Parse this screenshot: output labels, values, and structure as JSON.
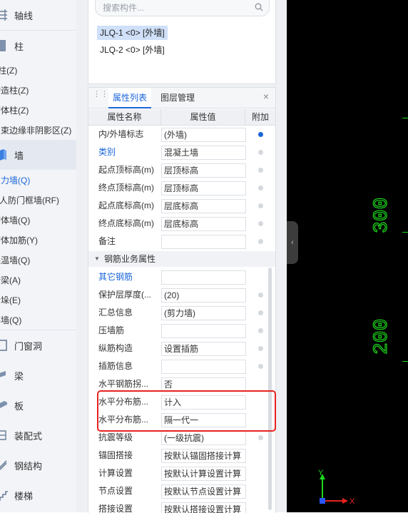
{
  "nav": {
    "groups": [
      {
        "label": "轴线",
        "icon": "axis-grid-icon"
      },
      {
        "label": "柱",
        "icon": "column-icon"
      },
      {
        "label": "墙",
        "icon": "wall-icon"
      },
      {
        "label": "门窗洞",
        "icon": "door-window-icon"
      },
      {
        "label": "梁",
        "icon": "beam-icon"
      },
      {
        "label": "板",
        "icon": "slab-icon"
      },
      {
        "label": "装配式",
        "icon": "prefab-icon"
      },
      {
        "label": "钢结构",
        "icon": "steel-structure-icon"
      },
      {
        "label": "楼梯",
        "icon": "stair-icon"
      }
    ],
    "column_items": [
      "柱(Z)",
      "构造柱(Z)",
      "砌体柱(Z)",
      "约束边缘非阴影区(Z)"
    ],
    "wall_items": [
      "剪力墙(Q)",
      "人防门框墙(RF)",
      "砌体墙(Q)",
      "砌体加筋(Y)",
      "保温墙(Q)",
      "暗梁(A)",
      "墙垛(E)",
      "幕墙(Q)"
    ]
  },
  "search": {
    "placeholder": "搜索构件..."
  },
  "components": [
    "JLQ-1 <0> [外墙]",
    "JLQ-2 <0> [外墙]"
  ],
  "tabs": {
    "properties": "属性列表",
    "layers": "图层管理",
    "close": "×"
  },
  "grid": {
    "headers": {
      "name": "属性名称",
      "value": "属性值",
      "extra": "附加"
    },
    "rows": [
      {
        "name": "内/外墙标志",
        "value": "(外墙)",
        "blue": false
      },
      {
        "name": "类别",
        "value": "混凝土墙",
        "blue": true
      },
      {
        "name": "起点顶标高(m)",
        "value": "层顶标高",
        "blue": false
      },
      {
        "name": "终点顶标高(m)",
        "value": "层顶标高",
        "blue": false
      },
      {
        "name": "起点底标高(m)",
        "value": "层底标高",
        "blue": false
      },
      {
        "name": "终点底标高(m)",
        "value": "层底标高",
        "blue": false
      },
      {
        "name": "备注",
        "value": "",
        "blue": false
      }
    ],
    "rebar_group": "钢筋业务属性",
    "rebar_rows": [
      {
        "name": "其它钢筋",
        "value": "",
        "blue": true
      },
      {
        "name": "保护层厚度(...",
        "value": "(20)",
        "blue": false
      },
      {
        "name": "汇总信息",
        "value": "(剪力墙)",
        "blue": false
      },
      {
        "name": "压墙筋",
        "value": "",
        "blue": false
      },
      {
        "name": "纵筋构造",
        "value": "设置插筋",
        "blue": false
      },
      {
        "name": "插筋信息",
        "value": "",
        "blue": false
      },
      {
        "name": "水平钢筋拐...",
        "value": "否",
        "blue": false
      },
      {
        "name": "水平分布筋...",
        "value": "计入",
        "blue": false
      },
      {
        "name": "水平分布筋...",
        "value": "隔一代一",
        "blue": false
      },
      {
        "name": "抗震等级",
        "value": "(一级抗震)",
        "blue": false
      },
      {
        "name": "锚固搭接",
        "value": "按默认锚固搭接计算",
        "blue": false
      },
      {
        "name": "计算设置",
        "value": "按默认计算设置计算",
        "blue": false
      },
      {
        "name": "节点设置",
        "value": "按默认节点设置计算",
        "blue": false
      },
      {
        "name": "搭接设置",
        "value": "按默认搭接设置计算",
        "blue": false
      }
    ]
  },
  "canvas": {
    "dim_top": "300",
    "dim_bottom": "200",
    "axis_y": "Y",
    "axis_x": "X",
    "line_color": "#1ed81e"
  }
}
